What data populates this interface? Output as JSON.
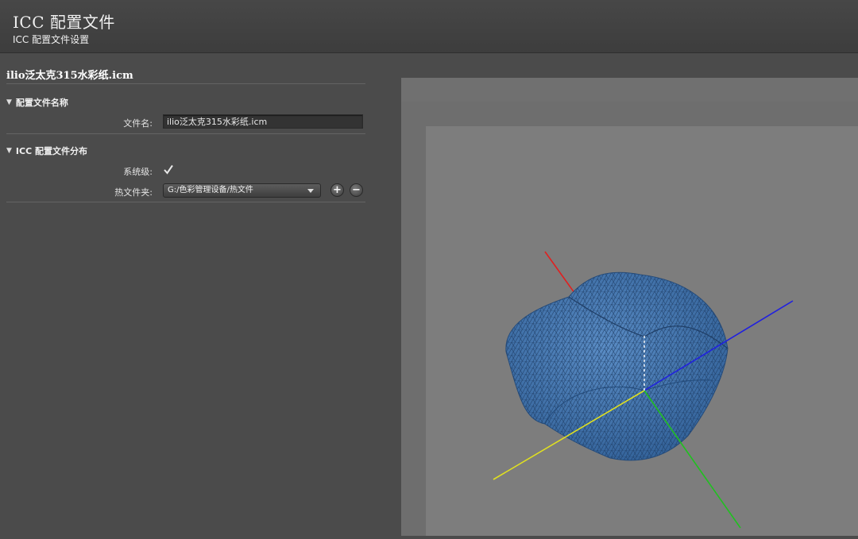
{
  "header": {
    "title": "ICC 配置文件",
    "subtitle": "ICC 配置文件设置"
  },
  "profile": {
    "file_title": "ilio泛太克315水彩纸.icm"
  },
  "section_name": {
    "heading": "配置文件名称",
    "filename_label": "文件名:",
    "filename_value": "ilio泛太克315水彩纸.icm"
  },
  "section_distribution": {
    "heading": "ICC 配置文件分布",
    "system_level_label": "系统级:",
    "system_level_checked": true,
    "hot_folder_label": "热文件夹:",
    "hot_folder_value": "G:/色彩管理设备/热文件",
    "add_icon": "plus-icon",
    "remove_icon": "minus-icon"
  },
  "gamut_view": {
    "mesh_color": "#3b6fa8",
    "wire_color": "#1f3e66",
    "axis_colors": {
      "x": "#e02020",
      "y": "#20c020",
      "z": "#2020e0",
      "w": "#e0e020"
    }
  }
}
